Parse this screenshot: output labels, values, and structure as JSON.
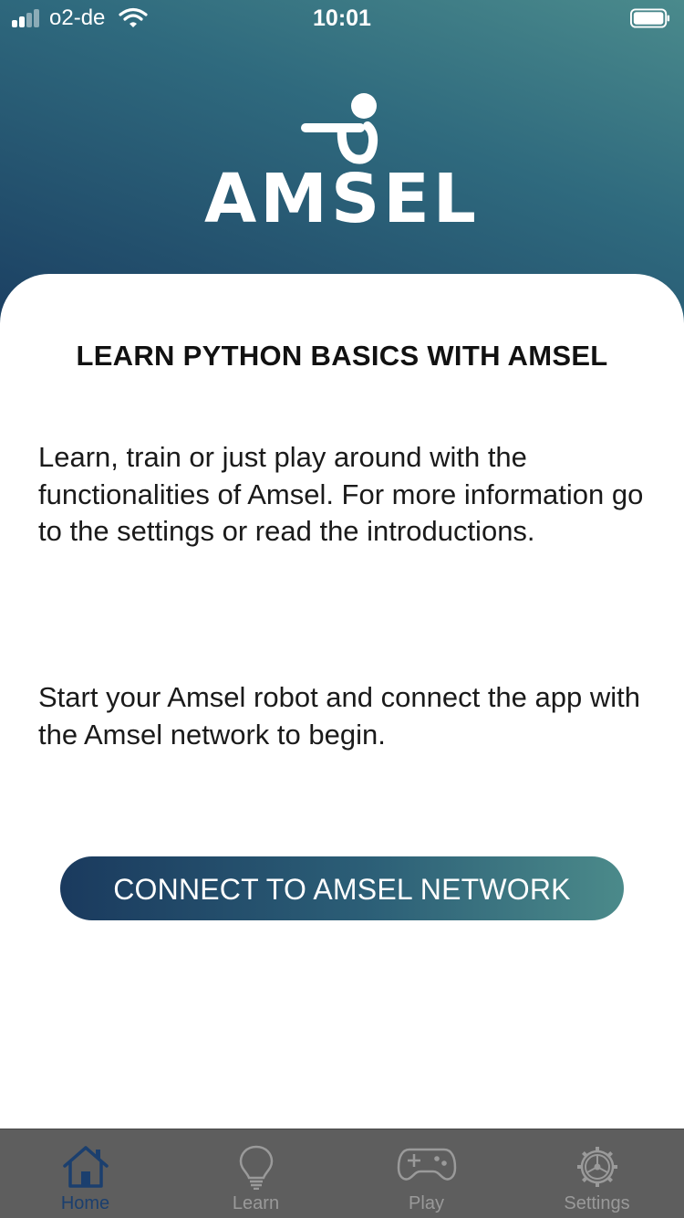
{
  "status_bar": {
    "carrier": "o2-de",
    "time": "10:01"
  },
  "header": {
    "logo_text": "AMSEL"
  },
  "content": {
    "title": "LEARN PYTHON BASICS WITH AMSEL",
    "intro": "Learn, train or just play around with the functionalities of Amsel. For more information go to the settings or read the introductions.",
    "start": "Start your Amsel robot and connect the app with the Amsel network to begin.",
    "connect_button": "CONNECT TO AMSEL NETWORK"
  },
  "tabs": [
    {
      "label": "Home",
      "icon": "home-icon",
      "active": true
    },
    {
      "label": "Learn",
      "icon": "lightbulb-icon",
      "active": false
    },
    {
      "label": "Play",
      "icon": "gamepad-icon",
      "active": false
    },
    {
      "label": "Settings",
      "icon": "gear-icon",
      "active": false
    }
  ],
  "colors": {
    "header_gradient_start": "#4a8a8c",
    "header_gradient_end": "#1b3f62",
    "tab_bar": "#5e5e5e",
    "tab_active": "#1b3f6e",
    "tab_inactive": "#9a9a9a"
  }
}
